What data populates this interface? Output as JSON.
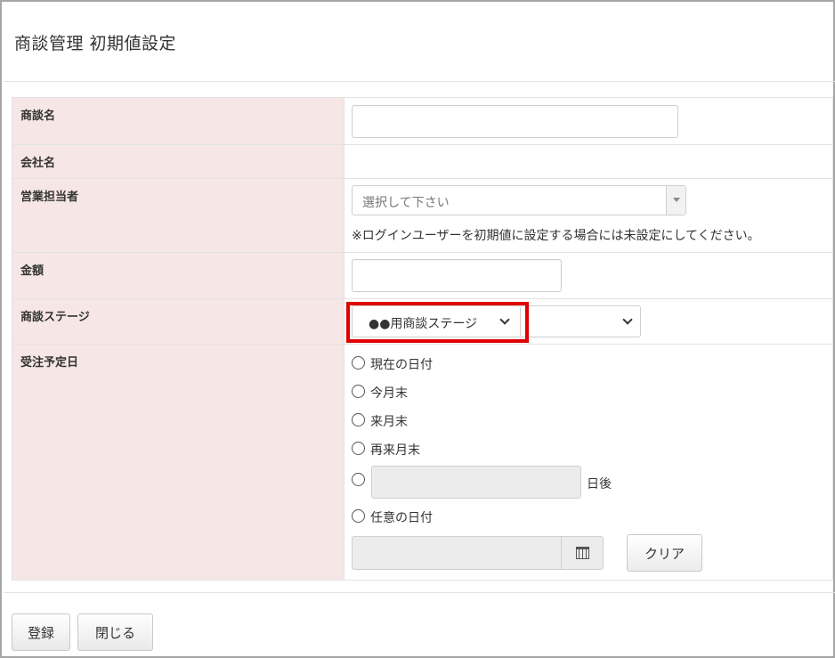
{
  "header": {
    "title": "商談管理 初期値設定"
  },
  "form": {
    "deal_name": {
      "label": "商談名",
      "value": ""
    },
    "company": {
      "label": "会社名",
      "value": ""
    },
    "sales_rep": {
      "label": "営業担当者",
      "placeholder": "選択して下さい",
      "note": "※ログインユーザーを初期値に設定する場合には未設定にしてください。"
    },
    "amount": {
      "label": "金額",
      "value": ""
    },
    "stage": {
      "label": "商談ステージ",
      "primary_value": "●●用商談ステージ",
      "secondary_value": ""
    },
    "order_date": {
      "label": "受注予定日",
      "options": [
        "現在の日付",
        "今月末",
        "来月末",
        "再来月末"
      ],
      "days_suffix": "日後",
      "custom_label": "任意の日付",
      "clear_label": "クリア"
    }
  },
  "footer": {
    "register_label": "登録",
    "close_label": "閉じる"
  }
}
